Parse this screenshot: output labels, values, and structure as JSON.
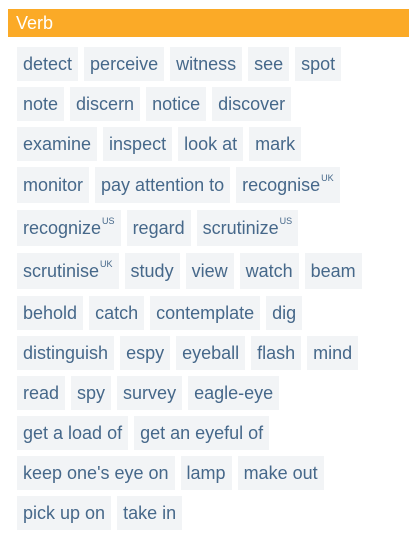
{
  "header": {
    "title": "Verb"
  },
  "rows": [
    {
      "tall": false,
      "chips": [
        {
          "word": "detect"
        },
        {
          "word": "perceive"
        },
        {
          "word": "witness"
        },
        {
          "word": "see"
        },
        {
          "word": "spot"
        }
      ]
    },
    {
      "tall": false,
      "chips": [
        {
          "word": "note"
        },
        {
          "word": "discern"
        },
        {
          "word": "notice"
        },
        {
          "word": "discover"
        }
      ]
    },
    {
      "tall": false,
      "chips": [
        {
          "word": "examine"
        },
        {
          "word": "inspect"
        },
        {
          "word": "look at"
        },
        {
          "word": "mark"
        }
      ]
    },
    {
      "tall": true,
      "chips": [
        {
          "word": "monitor"
        },
        {
          "word": "pay attention to"
        },
        {
          "word": "recognise",
          "tag": "UK"
        }
      ]
    },
    {
      "tall": true,
      "chips": [
        {
          "word": "recognize",
          "tag": "US"
        },
        {
          "word": "regard"
        },
        {
          "word": "scrutinize",
          "tag": "US"
        }
      ]
    },
    {
      "tall": true,
      "chips": [
        {
          "word": "scrutinise",
          "tag": "UK"
        },
        {
          "word": "study"
        },
        {
          "word": "view"
        },
        {
          "word": "watch"
        },
        {
          "word": "beam"
        }
      ]
    },
    {
      "tall": false,
      "chips": [
        {
          "word": "behold"
        },
        {
          "word": "catch"
        },
        {
          "word": "contemplate"
        },
        {
          "word": "dig"
        }
      ]
    },
    {
      "tall": false,
      "chips": [
        {
          "word": "distinguish"
        },
        {
          "word": "espy"
        },
        {
          "word": "eyeball"
        },
        {
          "word": "flash"
        },
        {
          "word": "mind"
        }
      ]
    },
    {
      "tall": false,
      "chips": [
        {
          "word": "read"
        },
        {
          "word": "spy"
        },
        {
          "word": "survey"
        },
        {
          "word": "eagle-eye"
        }
      ]
    },
    {
      "tall": false,
      "chips": [
        {
          "word": "get a load of"
        },
        {
          "word": "get an eyeful of"
        }
      ]
    },
    {
      "tall": false,
      "chips": [
        {
          "word": "keep one's eye on"
        },
        {
          "word": "lamp"
        },
        {
          "word": "make out"
        }
      ]
    },
    {
      "tall": false,
      "chips": [
        {
          "word": "pick up on"
        },
        {
          "word": "take in"
        }
      ]
    }
  ],
  "colors": {
    "header_bg": "#fbaa27",
    "header_text": "#ffffff",
    "chip_bg": "#f2f4f6",
    "chip_text": "#46688a"
  }
}
